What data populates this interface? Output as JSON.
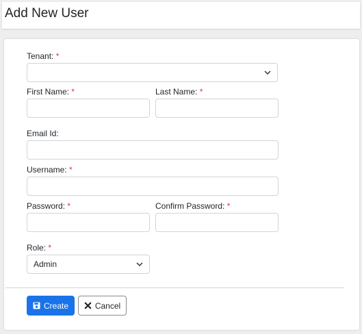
{
  "page": {
    "title": "Add New User"
  },
  "form": {
    "tenant": {
      "label": "Tenant:",
      "required": "*",
      "value": ""
    },
    "first_name": {
      "label": "First Name:",
      "required": "*",
      "value": ""
    },
    "last_name": {
      "label": "Last Name:",
      "required": "*",
      "value": ""
    },
    "email": {
      "label": "Email Id:",
      "value": ""
    },
    "username": {
      "label": "Username:",
      "required": "*",
      "value": ""
    },
    "password": {
      "label": "Password:",
      "required": "*",
      "value": ""
    },
    "confirm_password": {
      "label": "Confirm Password:",
      "required": "*",
      "value": ""
    },
    "role": {
      "label": "Role:",
      "required": "*",
      "value": "Admin"
    }
  },
  "actions": {
    "create_label": "Create",
    "cancel_label": "Cancel"
  },
  "colors": {
    "primary": "#1a73e8",
    "required": "#dc3545",
    "background": "#eeeeef"
  },
  "icons": {
    "create": "save-icon",
    "cancel": "close-icon",
    "dropdown": "chevron-down-icon"
  }
}
